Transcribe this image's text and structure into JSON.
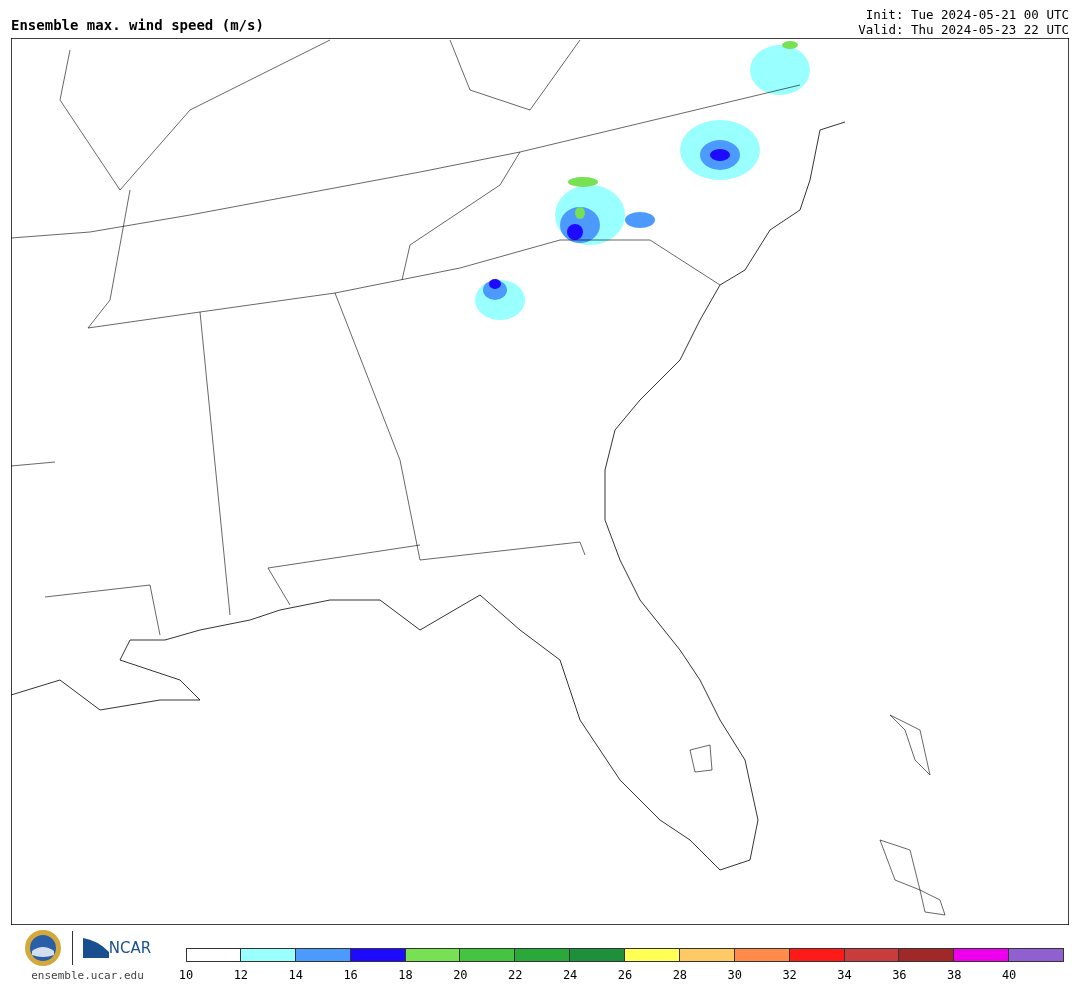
{
  "title": "Ensemble max. wind speed (m/s)",
  "init": "Init: Tue 2024-05-21 00 UTC",
  "valid": "Valid: Thu 2024-05-23 22 UTC",
  "logo": {
    "ncar_text": "NCAR",
    "site": "ensemble.ucar.edu"
  },
  "colorbar": {
    "bins": [
      {
        "color": "#ffffff"
      },
      {
        "color": "#99ffff"
      },
      {
        "color": "#4d9aff"
      },
      {
        "color": "#1e0aff"
      },
      {
        "color": "#77e053"
      },
      {
        "color": "#44c441"
      },
      {
        "color": "#2aa83a"
      },
      {
        "color": "#1e8f3a"
      },
      {
        "color": "#ffff55"
      },
      {
        "color": "#ffc966"
      },
      {
        "color": "#ff8a4a"
      },
      {
        "color": "#ff1a1a"
      },
      {
        "color": "#c83c3c"
      },
      {
        "color": "#a02828"
      },
      {
        "color": "#ee00ee"
      },
      {
        "color": "#9060d0"
      }
    ],
    "ticks": [
      "10",
      "12",
      "14",
      "16",
      "18",
      "20",
      "22",
      "24",
      "26",
      "28",
      "30",
      "32",
      "34",
      "36",
      "38",
      "40"
    ]
  }
}
